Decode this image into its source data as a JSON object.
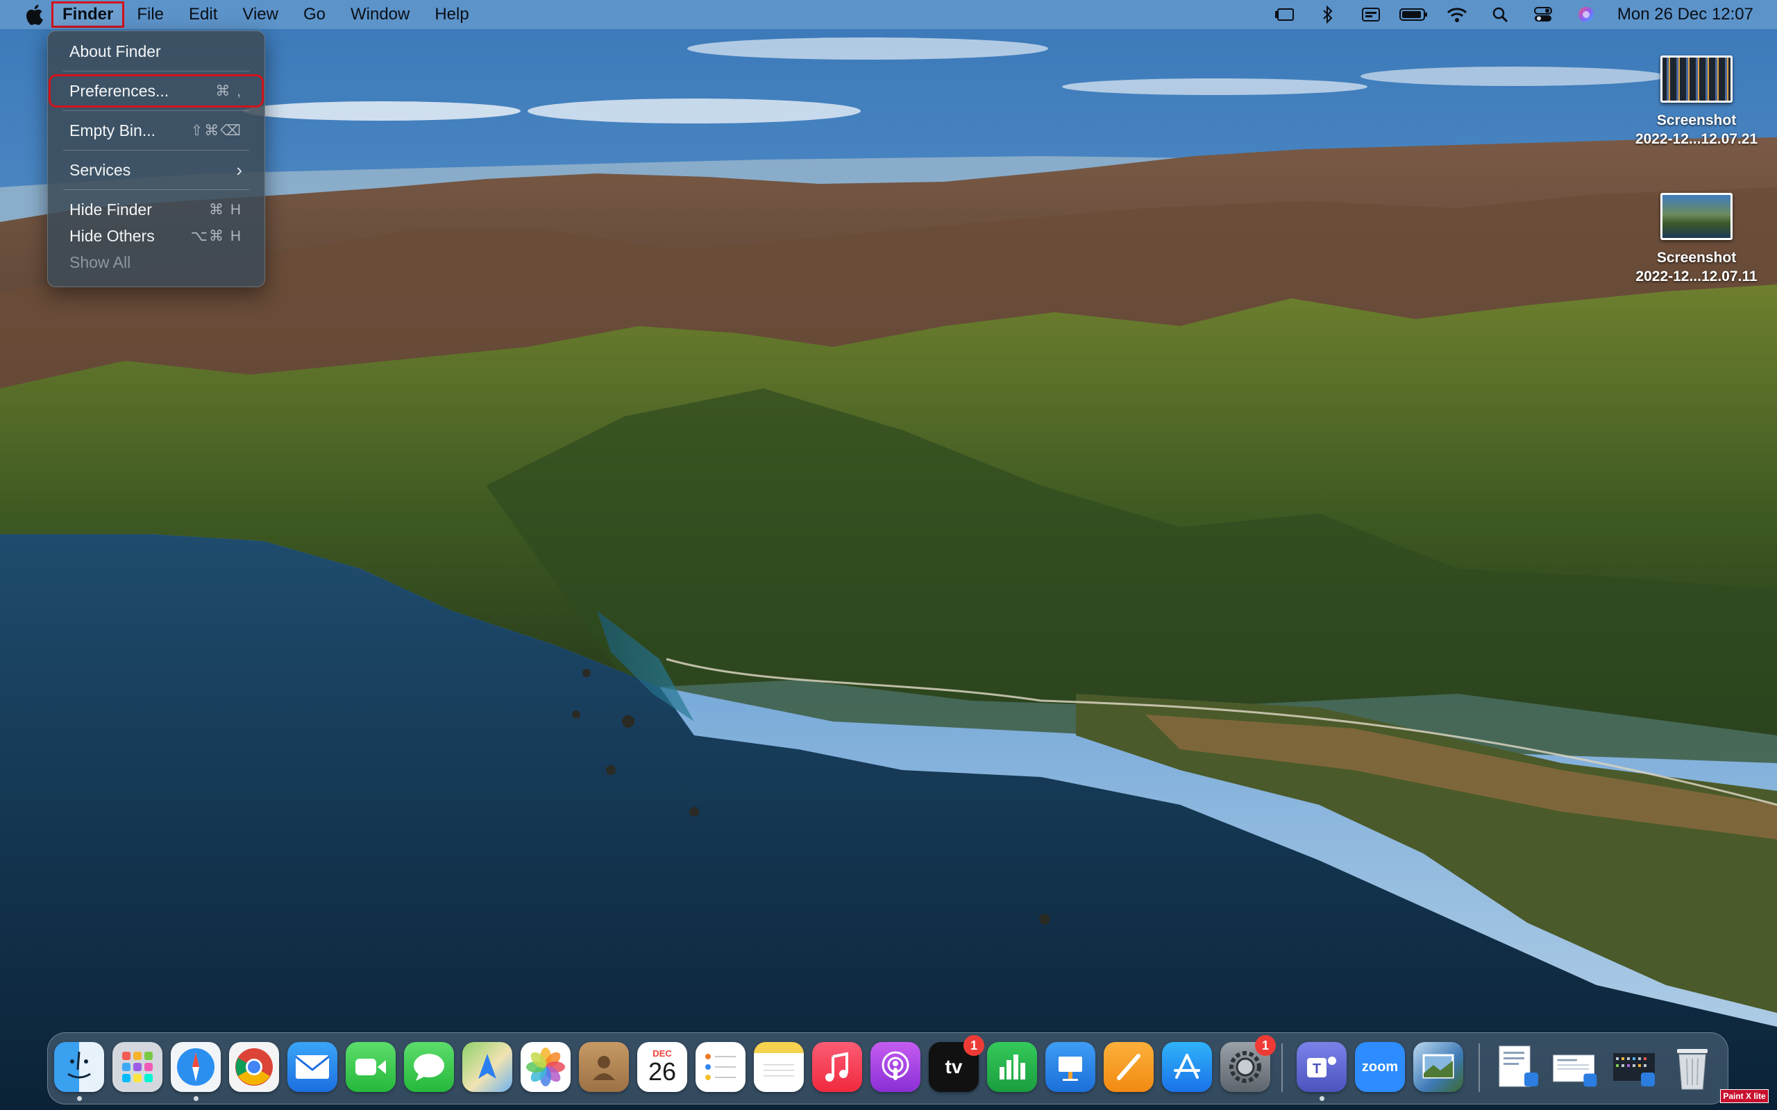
{
  "menubar": {
    "apple_icon": "apple-logo-icon",
    "items": [
      {
        "label": "Finder"
      },
      {
        "label": "File"
      },
      {
        "label": "Edit"
      },
      {
        "label": "View"
      },
      {
        "label": "Go"
      },
      {
        "label": "Window"
      },
      {
        "label": "Help"
      }
    ],
    "status_icons": [
      "stage-manager-icon",
      "bluetooth-icon",
      "input-source-icon",
      "battery-icon",
      "wifi-icon",
      "spotlight-search-icon",
      "control-center-icon",
      "siri-icon"
    ],
    "clock": "Mon 26 Dec  12:07"
  },
  "finder_menu": {
    "items": [
      {
        "label": "About Finder",
        "shortcut": ""
      },
      {
        "label": "Preferences...",
        "shortcut": "⌘ ,"
      },
      {
        "label": "Empty Bin...",
        "shortcut": "⇧⌘⌫"
      },
      {
        "label": "Services",
        "shortcut": ""
      },
      {
        "label": "Hide Finder",
        "shortcut": "⌘ H"
      },
      {
        "label": "Hide Others",
        "shortcut": "⌥⌘ H"
      },
      {
        "label": "Show All",
        "shortcut": ""
      }
    ]
  },
  "desktop": {
    "icons": [
      {
        "line1": "Screenshot",
        "line2": "2022-12...12.07.21"
      },
      {
        "line1": "Screenshot",
        "line2": "2022-12...12.07.11"
      }
    ]
  },
  "dock": {
    "apps": [
      {
        "name": "finder-icon",
        "running": true
      },
      {
        "name": "launchpad-icon",
        "running": false
      },
      {
        "name": "safari-icon",
        "running": true
      },
      {
        "name": "chrome-icon",
        "running": false
      },
      {
        "name": "mail-icon",
        "running": false
      },
      {
        "name": "facetime-icon",
        "running": false
      },
      {
        "name": "messages-icon",
        "running": false
      },
      {
        "name": "maps-icon",
        "running": false
      },
      {
        "name": "photos-icon",
        "running": false
      },
      {
        "name": "contacts-icon",
        "running": false
      },
      {
        "name": "calendar-icon",
        "running": false,
        "month": "DEC",
        "day": "26"
      },
      {
        "name": "reminders-icon",
        "running": false
      },
      {
        "name": "notes-icon",
        "running": false
      },
      {
        "name": "music-icon",
        "running": false
      },
      {
        "name": "podcasts-icon",
        "running": false
      },
      {
        "name": "apple-tv-icon",
        "running": false,
        "badge": "1",
        "text": "tv"
      },
      {
        "name": "numbers-icon",
        "running": false
      },
      {
        "name": "keynote-icon",
        "running": false
      },
      {
        "name": "pages-icon",
        "running": false
      },
      {
        "name": "app-store-icon",
        "running": false
      },
      {
        "name": "system-preferences-icon",
        "running": false,
        "badge": "1"
      },
      {
        "name": "teams-icon",
        "running": true
      },
      {
        "name": "zoom-icon",
        "running": false,
        "text": "zoom"
      },
      {
        "name": "preview-icon",
        "running": false
      }
    ],
    "right_items": [
      "document-stack-icon",
      "screenshot-stack-icon",
      "downloads-stack-icon",
      "trash-icon"
    ]
  },
  "watermark": "Paint X lite"
}
